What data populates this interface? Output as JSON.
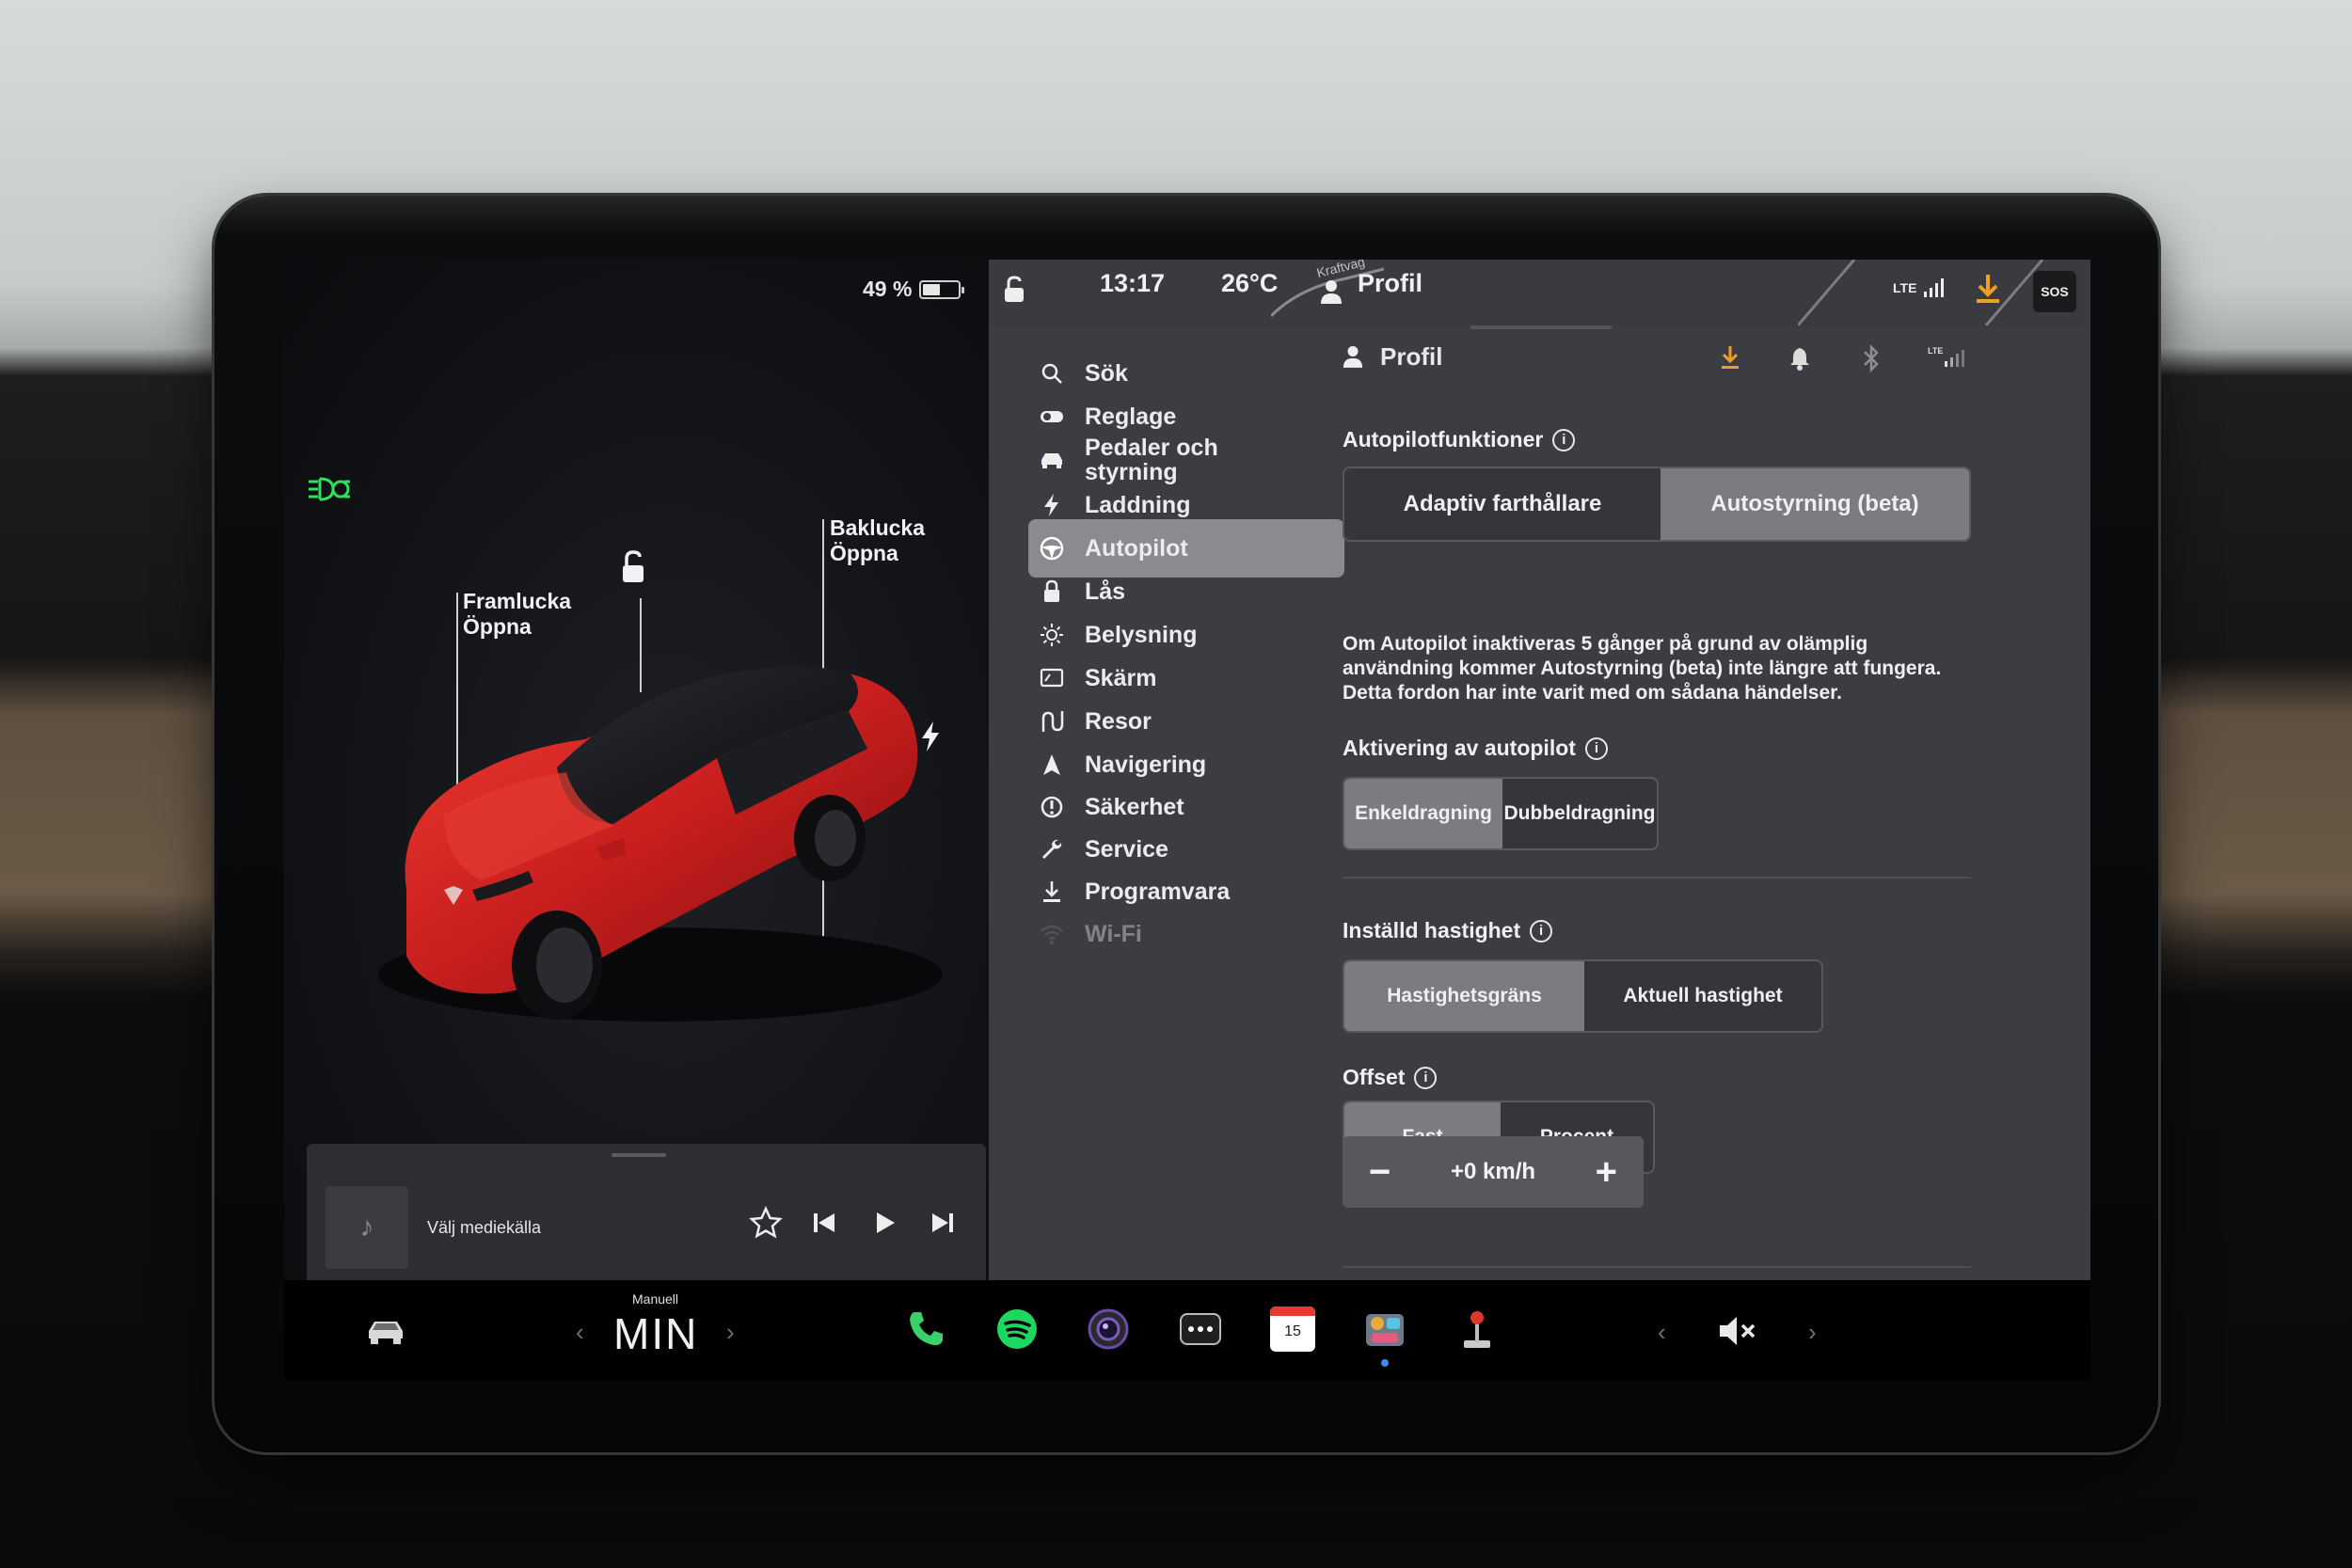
{
  "status": {
    "battery_percent": "49 %",
    "battery_level": 0.49,
    "time": "13:17",
    "temperature": "26°C",
    "profile": "Profil",
    "map_road": "Kraftvag",
    "network": "LTE",
    "sos": "SOS"
  },
  "car": {
    "front_trunk_title": "Framlucka",
    "front_trunk_action": "Öppna",
    "rear_trunk_title": "Baklucka",
    "rear_trunk_action": "Öppna",
    "body_color": "#c81e1e"
  },
  "media": {
    "source_label": "Välj mediekälla"
  },
  "menu": {
    "items": [
      {
        "label": "Sök",
        "icon": "search-icon"
      },
      {
        "label": "Reglage",
        "icon": "toggle-icon"
      },
      {
        "label": "Pedaler och styrning",
        "icon": "car-icon"
      },
      {
        "label": "Laddning",
        "icon": "bolt-icon"
      },
      {
        "label": "Autopilot",
        "icon": "steering-wheel-icon",
        "active": true
      },
      {
        "label": "Lås",
        "icon": "lock-icon"
      },
      {
        "label": "Belysning",
        "icon": "sun-icon"
      },
      {
        "label": "Skärm",
        "icon": "display-icon"
      },
      {
        "label": "Resor",
        "icon": "trips-icon"
      },
      {
        "label": "Navigering",
        "icon": "navigation-icon"
      },
      {
        "label": "Säkerhet",
        "icon": "safety-icon"
      },
      {
        "label": "Service",
        "icon": "wrench-icon"
      },
      {
        "label": "Programvara",
        "icon": "download-icon"
      },
      {
        "label": "Wi-Fi",
        "icon": "wifi-icon"
      }
    ]
  },
  "content": {
    "header_profile": "Profil",
    "autopilot_features": {
      "title": "Autopilotfunktioner",
      "options": [
        "Adaptiv farthållare",
        "Autostyrning (beta)"
      ],
      "selected": "Autostyrning (beta)",
      "note": "Om Autopilot inaktiveras 5 gånger på grund av olämplig användning kommer Autostyrning (beta) inte längre att fungera. Detta fordon har inte varit med om sådana händelser."
    },
    "activation": {
      "title": "Aktivering av autopilot",
      "options": [
        "Enkeldragning",
        "Dubbeldragning"
      ],
      "selected": "Enkeldragning"
    },
    "set_speed": {
      "title": "Inställd hastighet",
      "options": [
        "Hastighetsgräns",
        "Aktuell hastighet"
      ],
      "selected": "Hastighetsgräns"
    },
    "offset": {
      "title": "Offset",
      "options": [
        "Fast",
        "Procent"
      ],
      "selected": "Fast",
      "value": "+0 km/h"
    }
  },
  "dock": {
    "drive_mode_label": "Manuell",
    "drive_mode_value": "MIN",
    "calendar_day": "15",
    "apps": [
      "phone-icon",
      "spotify-icon",
      "camera-icon",
      "more-icon",
      "calendar-icon",
      "toybox-icon",
      "joystick-icon"
    ],
    "volume": "muted"
  },
  "colors": {
    "accent_orange": "#f0a020",
    "headlight_green": "#2ee05a",
    "spotify_green": "#1ed760",
    "phone_green": "#3ad16a"
  }
}
